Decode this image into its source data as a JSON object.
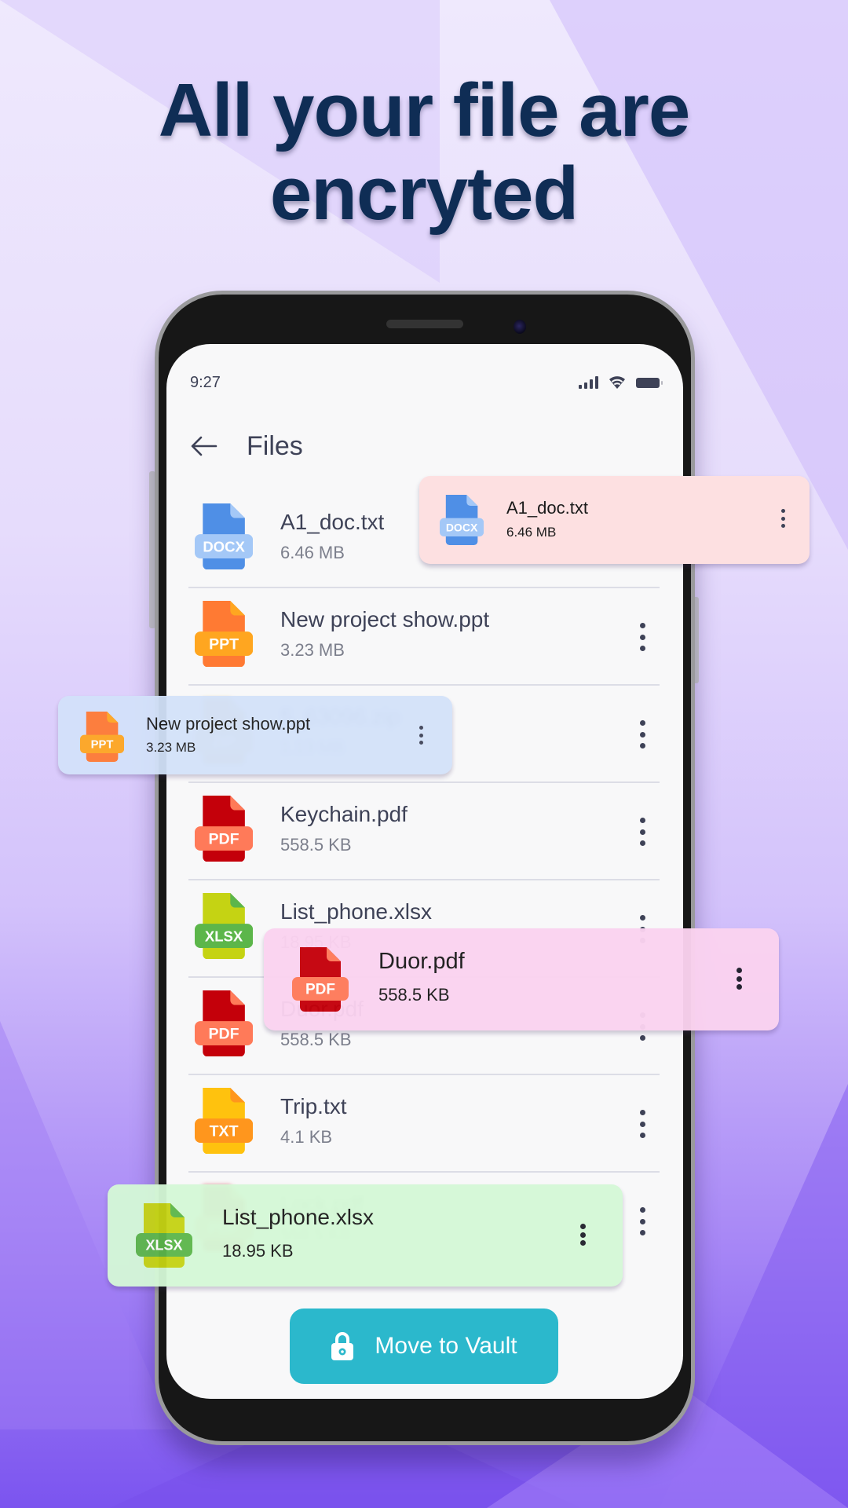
{
  "headline": {
    "line1": "All your file are",
    "line2": "encryted"
  },
  "status_bar": {
    "time": "9:27",
    "icons": [
      "signal-icon",
      "wifi-icon",
      "battery-icon"
    ]
  },
  "app_bar": {
    "back_icon": "arrow-left-icon",
    "title": "Files"
  },
  "files": [
    {
      "name": "A1_doc.txt",
      "size": "6.46 MB",
      "type": "DOCX",
      "color": "#4f8fe6",
      "label_color": "#a4c8f7",
      "fold": "#a4c8f7"
    },
    {
      "name": "New project show.ppt",
      "size": "3.23 MB",
      "type": "PPT",
      "color": "#ff7a33",
      "label_color": "#ffa620",
      "fold": "#ffa620"
    },
    {
      "name": "5_63096.zip",
      "size": "1.13 MB",
      "type": "ZIP",
      "color": "#e0a93a",
      "label_color": "#f0c062",
      "fold": "#f0c062"
    },
    {
      "name": "Keychain.pdf",
      "size": "558.5 KB",
      "type": "PDF",
      "color": "#c4000a",
      "label_color": "#ff7a59",
      "fold": "#ff7a59"
    },
    {
      "name": "List_phone.xlsx",
      "size": "18.95 KB",
      "type": "XLSX",
      "color": "#c5d313",
      "label_color": "#5cb64a",
      "fold": "#5cb64a"
    },
    {
      "name": "Duor.pdf",
      "size": "558.5 KB",
      "type": "PDF",
      "color": "#c4000a",
      "label_color": "#ff7a59",
      "fold": "#ff7a59"
    },
    {
      "name": "Trip.txt",
      "size": "4.1 KB",
      "type": "TXT",
      "color": "#ffc20e",
      "label_color": "#ff961d",
      "fold": "#ff961d"
    },
    {
      "name": "Lock.pdf",
      "size": "558.5 KB",
      "type": "PDF",
      "color": "#c4000a",
      "label_color": "#ff7a59",
      "fold": "#ff7a59"
    }
  ],
  "floating_cards": [
    {
      "name": "A1_doc.txt",
      "size": "6.46 MB",
      "type": "DOCX",
      "bg": "#fde0e1"
    },
    {
      "name": "New project show.ppt",
      "size": "3.23 MB",
      "type": "PPT",
      "bg": "#d3e2fa"
    },
    {
      "name": "Duor.pdf",
      "size": "558.5 KB",
      "type": "PDF",
      "bg": "#fbd3f0"
    },
    {
      "name": "List_phone.xlsx",
      "size": "18.95 KB",
      "type": "XLSX",
      "bg": "#d5f9d7"
    }
  ],
  "actions": {
    "move_to_vault": "Move to Vault",
    "lock_icon": "lock-icon",
    "accent_color": "#2bb8cc"
  }
}
